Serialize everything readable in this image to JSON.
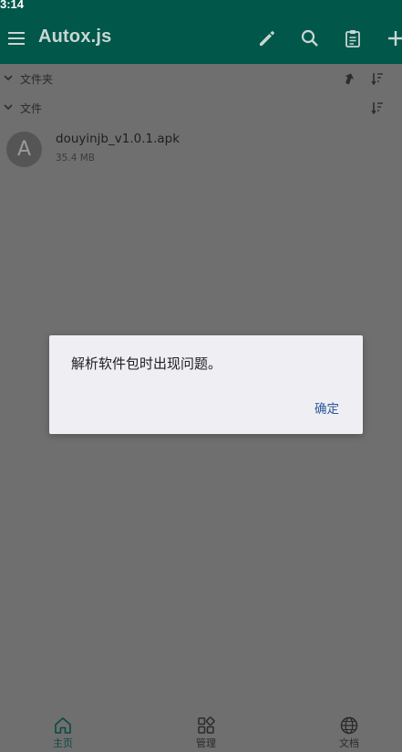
{
  "status_bar": {
    "time": "3:14"
  },
  "toolbar": {
    "title": "Autox.js",
    "icons": [
      "menu-icon",
      "edit-icon",
      "search-icon",
      "clipboard-icon",
      "add-icon"
    ]
  },
  "sections": [
    {
      "label": "文件夹",
      "icons": [
        "upload-icon",
        "sort-icon"
      ]
    },
    {
      "label": "文件",
      "icons": [
        "sort-icon"
      ]
    }
  ],
  "files": [
    {
      "avatar_letter": "A",
      "name": "douyinjb_v1.0.1.apk",
      "size": "35.4 MB"
    }
  ],
  "dialog": {
    "message": "解析软件包时出现问题。",
    "ok_label": "确定"
  },
  "bottom_nav": {
    "items": [
      {
        "label": "主页",
        "icon": "home-icon",
        "active": true
      },
      {
        "label": "管理",
        "icon": "grid-icon",
        "active": false
      },
      {
        "label": "文档",
        "icon": "globe-icon",
        "active": false
      }
    ]
  },
  "colors": {
    "app_bar": "#00574a",
    "overlay_background": "#6f6f6f",
    "dialog_background": "#efeef3",
    "dialog_button": "#2a5a9a",
    "nav_active": "#0a4a42"
  }
}
